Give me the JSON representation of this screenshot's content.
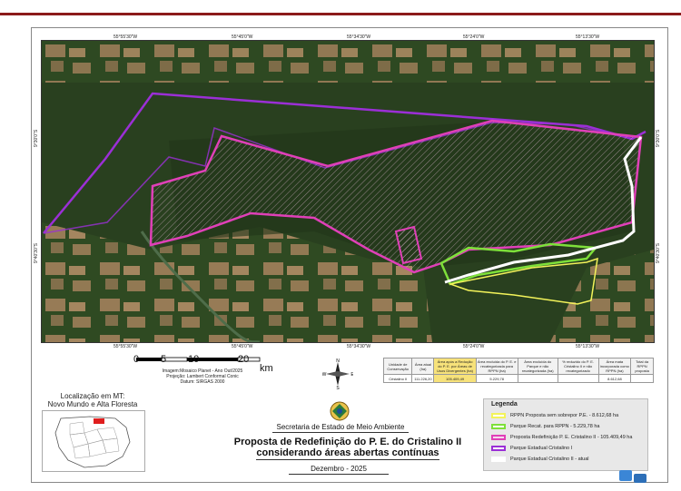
{
  "map": {
    "coords_top": [
      "55°55'30\"W",
      "55°45'0\"W",
      "55°34'30\"W",
      "55°24'0\"W",
      "55°13'30\"W"
    ],
    "coords_bottom": [
      "55°55'30\"W",
      "55°45'0\"W",
      "55°34'30\"W",
      "55°24'0\"W",
      "55°13'30\"W"
    ],
    "coords_left": [
      "9°30'0\"S",
      "9°40'30\"S"
    ],
    "coords_right": [
      "9°30'0\"S",
      "9°40'30\"S"
    ]
  },
  "scale": {
    "labels": [
      "0",
      "5",
      "10",
      "20"
    ],
    "unit": "km"
  },
  "credits": [
    "Imagem:Mosaico Planet - Ano Out/2025",
    "Projeção: Lambert Conformal Conic",
    "Datum: SIRGAS 2000"
  ],
  "north_letters": {
    "n": "N",
    "s": "S",
    "e": "E",
    "w": "W"
  },
  "table": {
    "headers": [
      "Unidade de Conservação",
      "Área atual (ha)",
      "Área após a Redução do P. E. por Áreas de Usos Divergentes (ha)",
      "Área excluída do P. E. e recategorizada para RPPN (ha)",
      "Área excluída do Parque e não recategorizada (ha)",
      "% reduzido do P. E. Cristalino II e não recategorizado",
      "Área mata incorporada como RPPN (ha)",
      "Total da RPPN proposta"
    ],
    "values": [
      "Cristalino II",
      "111.226,20",
      "105.409,49",
      "5.229,78",
      "",
      "",
      "8.612,68",
      ""
    ]
  },
  "location": {
    "title_line1": "Localização em MT:",
    "title_line2": "Novo Mundo e Alta Floresta"
  },
  "department": "Secretaria de Estado de Meio Ambiente",
  "title": {
    "line1": "Proposta de Redefinição do P. E. do Cristalino II",
    "line2": "considerando áreas abertas contínuas"
  },
  "date": "Dezembro - 2025",
  "legend": {
    "title": "Legenda",
    "items": [
      {
        "label": "RPPN Proposta sem sobrepor P.E. - 8.612,68 ha",
        "color": "#f3f35a",
        "fill": "#ffffff"
      },
      {
        "label": "Parque Recat. para RPPN - 5.229,78 ha",
        "color": "#7ee03a",
        "fill": "#ffffff"
      },
      {
        "label": "Proposta Redefinição P. E. Cristalino II - 105.409,49 ha",
        "color": "#e040b8",
        "fill": "#f6d9ee"
      },
      {
        "label": "Parque Estadual Cristalino I",
        "color": "#9b2fd6",
        "fill": "#ffffff"
      },
      {
        "label": "Parque Estadual Cristalino II - atual",
        "color": "#ffffff",
        "fill": "#ffffff"
      }
    ]
  }
}
